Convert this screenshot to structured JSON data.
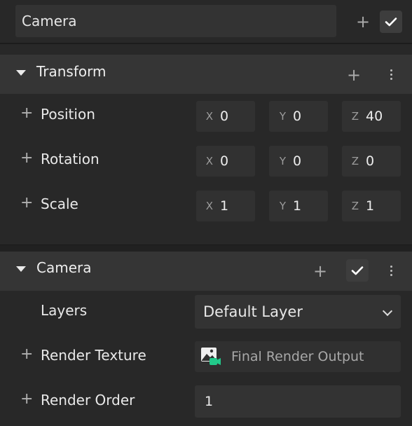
{
  "header": {
    "object_name": "Camera",
    "add_icon": "plus-icon",
    "enabled_icon": "checkmark-icon"
  },
  "transform": {
    "title": "Transform",
    "icons": [
      "caret-down-icon",
      "plus-icon",
      "more-vertical-icon"
    ],
    "rows": [
      {
        "label": "Position",
        "x": "0",
        "y": "0",
        "z": "40"
      },
      {
        "label": "Rotation",
        "x": "0",
        "y": "0",
        "z": "0"
      },
      {
        "label": "Scale",
        "x": "1",
        "y": "1",
        "z": "1"
      }
    ],
    "axis_labels": {
      "x": "X",
      "y": "Y",
      "z": "Z"
    }
  },
  "camera": {
    "title": "Camera",
    "icons": [
      "caret-down-icon",
      "plus-icon",
      "checkmark-icon",
      "more-vertical-icon"
    ],
    "layers_label": "Layers",
    "layers_value": "Default Layer",
    "render_texture_label": "Render Texture",
    "render_texture_value": "Final Render Output",
    "render_texture_icon": "render-target-icon",
    "render_order_label": "Render Order",
    "render_order_value": "1"
  },
  "colors": {
    "background": "#282828",
    "header_bg": "#353535",
    "field_bg": "#333333",
    "accent_green": "#22c98a"
  }
}
